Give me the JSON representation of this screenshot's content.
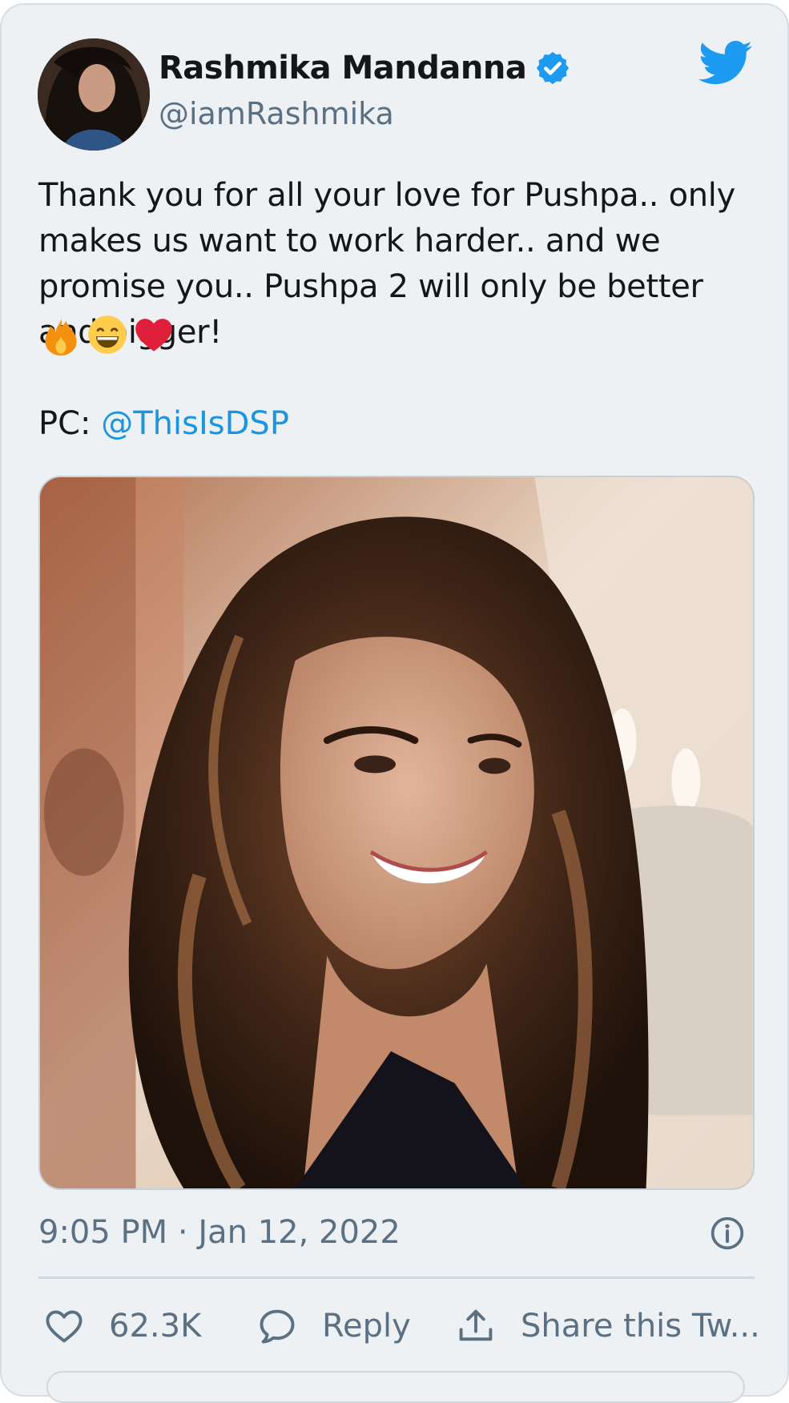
{
  "author": {
    "display_name": "Rashmika Mandanna",
    "handle": "@iamRashmika",
    "verified": true
  },
  "tweet": {
    "text": "Thank you for all your love for Pushpa.. only makes us want to work harder.. and we promise you.. Pushpa 2 will only be better and bigger!",
    "emojis": [
      "fire-emoji",
      "grinning-emoji",
      "red-heart-emoji"
    ],
    "credit_prefix": "PC: ",
    "credit_mention": "@ThisIsDSP"
  },
  "meta": {
    "timestamp": "9:05 PM · Jan 12, 2022"
  },
  "actions": {
    "like_count": "62.3K",
    "reply_label": "Reply",
    "share_label": "Share this Tw..."
  },
  "icons": {
    "brand": "twitter-bird-icon",
    "verified": "verified-badge-icon",
    "info": "info-icon",
    "like": "heart-icon",
    "reply": "speech-bubble-icon",
    "share": "share-upload-icon"
  },
  "colors": {
    "brand_blue": "#1d9bf0",
    "link_blue": "#1b95e0",
    "text_primary": "#14171a",
    "text_secondary": "#5b7083",
    "card_background": "#edf1f4",
    "heart_red": "#e0203a"
  }
}
